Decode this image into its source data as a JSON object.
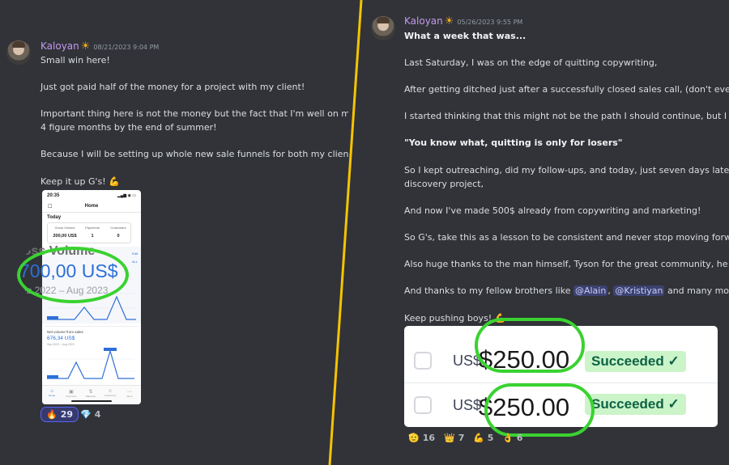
{
  "left": {
    "username": "Kaloyan",
    "badge": "☀",
    "timestamp": "08/21/2023 9:04 PM",
    "lines": [
      "Small win here!",
      "Just got paid half of the money for a project with my client!",
      "Important thing here is not the money but the fact that I'm well on m",
      "4 figure months by the end of summer!",
      "Because I will be setting up whole new sale funnels for both my client",
      "Keep it up G's! 💪"
    ],
    "phone": {
      "status_time": "20:35",
      "status_icons": "▂▄▆ ◉ ▭",
      "title": "Home",
      "menu": "☐",
      "section": "Today",
      "metrics": [
        {
          "label": "Gross Volume",
          "value": "200,00 US$"
        },
        {
          "label": "Payments",
          "value": "1"
        },
        {
          "label": "Customers",
          "value": "0"
        }
      ],
      "gross_label": "Gross Volume",
      "gross_value": "700,00 US$",
      "gross_range": "Sep 2022 – Aug 2023",
      "side_links": [
        "Edit",
        "ALL"
      ],
      "net_label": "Net volume from sales",
      "net_value": "676,34 US$",
      "net_range": "Sep 2022 – Aug 2023",
      "tabs": [
        "Home",
        "Payments",
        "Balances",
        "Customers",
        "More"
      ]
    },
    "reactions": [
      {
        "emoji": "🔥",
        "count": "29"
      },
      {
        "emoji": "💎",
        "count": "4"
      }
    ]
  },
  "right": {
    "username": "Kaloyan",
    "badge": "☀",
    "timestamp": "05/26/2023 9:55 PM",
    "headline": "What a week that was...",
    "lines": [
      "Last Saturday, I was on the edge of quitting copywriting,",
      "After getting ditched just after a successfully closed sales call, (don't even wan",
      "I started thinking that this might not be the path I should continue, but I said to",
      "\"You know what, quitting is only for losers\"",
      "So I kept outreaching, did my follow-ups, and today, just seven days later, I got",
      "discovery project,",
      "And now I've made 500$ already from copywriting and marketing!",
      "So G's, take this as a lesson to be consistent and never stop moving forward!",
      "Also huge thanks to the man himself, Tyson for the great community, he has cr"
    ],
    "thanks_prefix": "And thanks to my fellow brothers like ",
    "mention_1": "@Alain",
    "separator": ", ",
    "mention_2": "@Kristiyan",
    "thanks_suffix": " and many more for",
    "closing": "Keep pushing boys! 💪",
    "payments": [
      {
        "currency": "US$",
        "amount": "$250.00",
        "status": "Succeeded ✓"
      },
      {
        "currency": "US$",
        "amount": "$250.00",
        "status": "Succeeded ✓"
      }
    ],
    "reactions": [
      {
        "emoji": "🫡",
        "count": "16"
      },
      {
        "emoji": "👑",
        "count": "7"
      },
      {
        "emoji": "💪",
        "count": "5"
      },
      {
        "emoji": "👌",
        "count": "6"
      }
    ]
  },
  "colors": {
    "background": "#313338",
    "username": "#c597f0",
    "divider": "#f5c400",
    "highlight_ring": "#3ad231",
    "succeeded_bg": "#cbf4c9"
  }
}
